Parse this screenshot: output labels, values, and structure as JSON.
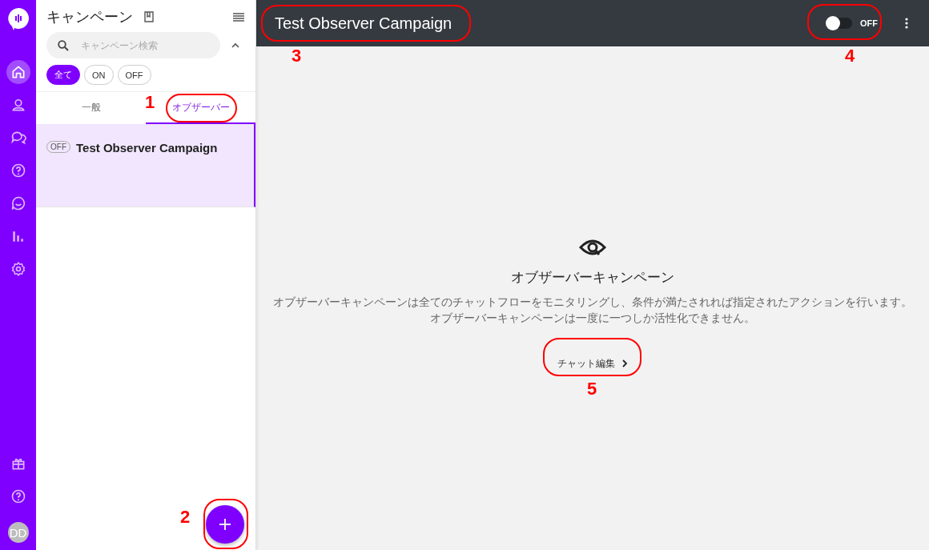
{
  "nav": {
    "items": [
      {
        "kind": "home",
        "selected": true
      },
      {
        "kind": "user",
        "selected": false
      },
      {
        "kind": "chat",
        "selected": false
      },
      {
        "kind": "help",
        "selected": false
      },
      {
        "kind": "smile",
        "selected": false
      },
      {
        "kind": "stats",
        "selected": false
      },
      {
        "kind": "settings",
        "selected": false
      }
    ],
    "bottom": [
      {
        "kind": "gift",
        "selected": false
      },
      {
        "kind": "help",
        "selected": false
      }
    ],
    "avatar": "DD"
  },
  "panel": {
    "title": "キャンペーン",
    "search": {
      "placeholder": "キャンペーン検索"
    },
    "filters": [
      {
        "label": "全て",
        "selected": true
      },
      {
        "label": "ON",
        "selected": false
      },
      {
        "label": "OFF",
        "selected": false
      }
    ],
    "tabs": [
      {
        "label": "一般",
        "selected": false
      },
      {
        "label": "オブザーバー",
        "selected": true
      }
    ],
    "campaigns": [
      {
        "status": "OFF",
        "name": "Test Observer Campaign",
        "selected": true
      }
    ]
  },
  "header": {
    "title": "Test Observer Campaign",
    "toggle": {
      "on": false,
      "label": "OFF"
    }
  },
  "empty_state": {
    "title": "オブザーバーキャンペーン",
    "lines": [
      "オブザーバーキャンペーンは全てのチャットフローをモニタリングし、条件が満たされれば指定されたアクションを行います。",
      "オブザーバーキャンペーンは一度に一つしか活性化できません。"
    ],
    "button": "チャット編集"
  },
  "annotations": [
    {
      "label": "1"
    },
    {
      "label": "2"
    },
    {
      "label": "3"
    },
    {
      "label": "4"
    },
    {
      "label": "5"
    }
  ]
}
